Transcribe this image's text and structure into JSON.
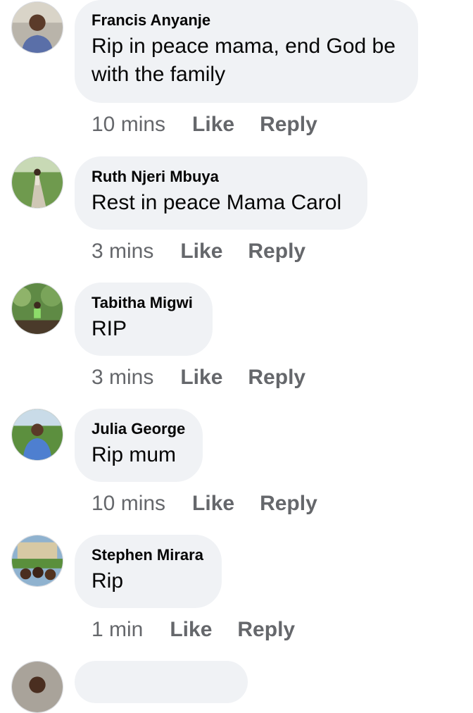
{
  "comments": [
    {
      "author": "Francis Anyanje",
      "text": "Rip in peace mama, end God be with the family",
      "time": "10 mins",
      "like_label": "Like",
      "reply_label": "Reply",
      "avatar_icon": "profile-photo-icon"
    },
    {
      "author": "Ruth Njeri Mbuya",
      "text": "Rest in peace Mama Carol",
      "time": "3 mins",
      "like_label": "Like",
      "reply_label": "Reply",
      "avatar_icon": "profile-photo-icon"
    },
    {
      "author": "Tabitha Migwi",
      "text": "RIP",
      "time": "3 mins",
      "like_label": "Like",
      "reply_label": "Reply",
      "avatar_icon": "profile-photo-icon"
    },
    {
      "author": "Julia George",
      "text": "Rip mum",
      "time": "10 mins",
      "like_label": "Like",
      "reply_label": "Reply",
      "avatar_icon": "profile-photo-icon"
    },
    {
      "author": "Stephen Mirara",
      "text": "Rip",
      "time": "1 min",
      "like_label": "Like",
      "reply_label": "Reply",
      "avatar_icon": "profile-photo-icon"
    }
  ],
  "colors": {
    "bubble": "#f0f2f5",
    "text": "#050505",
    "meta": "#65676b",
    "background": "#ffffff"
  }
}
